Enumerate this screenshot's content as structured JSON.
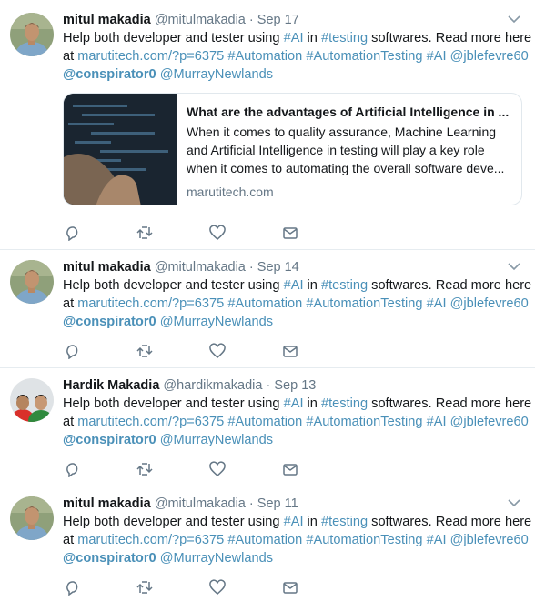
{
  "tweets": [
    {
      "name": "mitul makadia",
      "handle": "@mitulmakadia",
      "dot": "·",
      "date": "Sep 17",
      "avatar": "mitul",
      "text": {
        "part1": "Help both developer and tester using ",
        "tag_ai": "#AI",
        "in": " in ",
        "tag_testing": "#testing",
        "part2": " softwares. Read more here",
        "at": "at ",
        "url": "marutitech.com/?p=6375",
        "tag_automation": "#Automation",
        "tag_automationtesting": "#AutomationTesting",
        "tag_ai2": "#AI",
        "mention1": "@jblefevre60",
        "mention2": "@conspirator0",
        "mention3": "@MurrayNewlands"
      },
      "card": {
        "title": "What are the advantages of Artificial Intelligence in ...",
        "desc1": "When it comes to quality assurance, Machine Learning",
        "desc2": "and Artificial Intelligence in testing will play a key role",
        "desc3": "when it comes to automating the overall software deve...",
        "domain": "marutitech.com"
      }
    },
    {
      "name": "mitul makadia",
      "handle": "@mitulmakadia",
      "dot": "·",
      "date": "Sep 14",
      "avatar": "mitul",
      "text": {
        "part1": "Help both developer and tester using ",
        "tag_ai": "#AI",
        "in": " in ",
        "tag_testing": "#testing",
        "part2": " softwares. Read more here",
        "at": "at ",
        "url": "marutitech.com/?p=6375",
        "tag_automation": "#Automation",
        "tag_automationtesting": "#AutomationTesting",
        "tag_ai2": "#AI",
        "mention1": "@jblefevre60",
        "mention2": "@conspirator0",
        "mention3": "@MurrayNewlands"
      }
    },
    {
      "name": "Hardik Makadia",
      "handle": "@hardikmakadia",
      "dot": "·",
      "date": "Sep 13",
      "avatar": "hardik",
      "text": {
        "part1": "Help both developer and tester using ",
        "tag_ai": "#AI",
        "in": " in ",
        "tag_testing": "#testing",
        "part2": " softwares. Read more here",
        "at": "at ",
        "url": "marutitech.com/?p=6375",
        "tag_automation": "#Automation",
        "tag_automationtesting": "#AutomationTesting",
        "tag_ai2": "#AI",
        "mention1": "@jblefevre60",
        "mention2": "@conspirator0",
        "mention3": "@MurrayNewlands"
      }
    },
    {
      "name": "mitul makadia",
      "handle": "@mitulmakadia",
      "dot": "·",
      "date": "Sep 11",
      "avatar": "mitul",
      "text": {
        "part1": "Help both developer and tester using ",
        "tag_ai": "#AI",
        "in": " in ",
        "tag_testing": "#testing",
        "part2": " softwares. Read more here",
        "at": "at ",
        "url": "marutitech.com/?p=6375",
        "tag_automation": "#Automation",
        "tag_automationtesting": "#AutomationTesting",
        "tag_ai2": "#AI",
        "mention1": "@jblefevre60",
        "mention2": "@conspirator0",
        "mention3": "@MurrayNewlands"
      }
    }
  ],
  "icons": {
    "caret": "chevron-down-icon",
    "reply": "reply-icon",
    "retweet": "retweet-icon",
    "like": "heart-icon",
    "dm": "envelope-icon"
  },
  "colors": {
    "link": "#4a90b8",
    "muted": "#657786",
    "border": "#e6ecf0",
    "icon": "#657786"
  }
}
